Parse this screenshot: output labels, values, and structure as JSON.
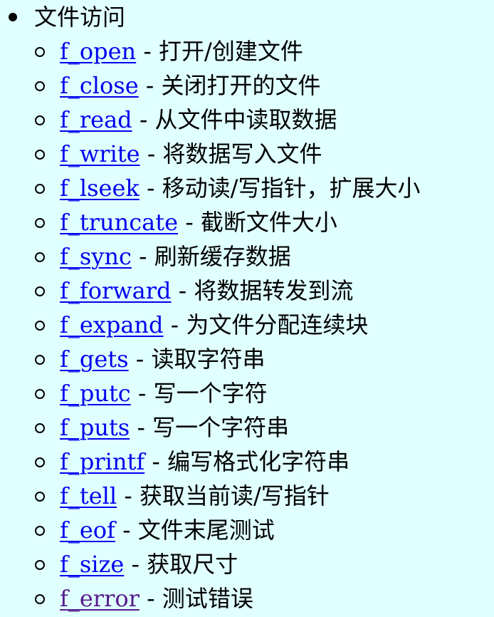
{
  "section": {
    "title": "文件访问",
    "separator": " - ",
    "items": [
      {
        "name": "f_open",
        "desc": "打开/创建文件",
        "visited": false
      },
      {
        "name": "f_close",
        "desc": "关闭打开的文件",
        "visited": false
      },
      {
        "name": "f_read",
        "desc": "从文件中读取数据",
        "visited": false
      },
      {
        "name": "f_write",
        "desc": "将数据写入文件",
        "visited": false
      },
      {
        "name": "f_lseek",
        "desc": "移动读/写指针，扩展大小",
        "visited": false
      },
      {
        "name": "f_truncate",
        "desc": "截断文件大小",
        "visited": false
      },
      {
        "name": "f_sync",
        "desc": "刷新缓存数据",
        "visited": false
      },
      {
        "name": "f_forward",
        "desc": "将数据转发到流",
        "visited": false
      },
      {
        "name": "f_expand",
        "desc": "为文件分配连续块",
        "visited": false
      },
      {
        "name": "f_gets",
        "desc": "读取字符串",
        "visited": false
      },
      {
        "name": "f_putc",
        "desc": "写一个字符",
        "visited": false
      },
      {
        "name": "f_puts",
        "desc": "写一个字符串",
        "visited": false
      },
      {
        "name": "f_printf",
        "desc": "编写格式化字符串",
        "visited": false
      },
      {
        "name": "f_tell",
        "desc": "获取当前读/写指针",
        "visited": false
      },
      {
        "name": "f_eof",
        "desc": "文件末尾测试",
        "visited": false
      },
      {
        "name": "f_size",
        "desc": "获取尺寸",
        "visited": false
      },
      {
        "name": "f_error",
        "desc": "测试错误",
        "visited": true
      }
    ]
  },
  "colors": {
    "background": "#e0ffff",
    "link": "#0000ee",
    "visited_link": "#551a8b",
    "text": "#000000"
  }
}
